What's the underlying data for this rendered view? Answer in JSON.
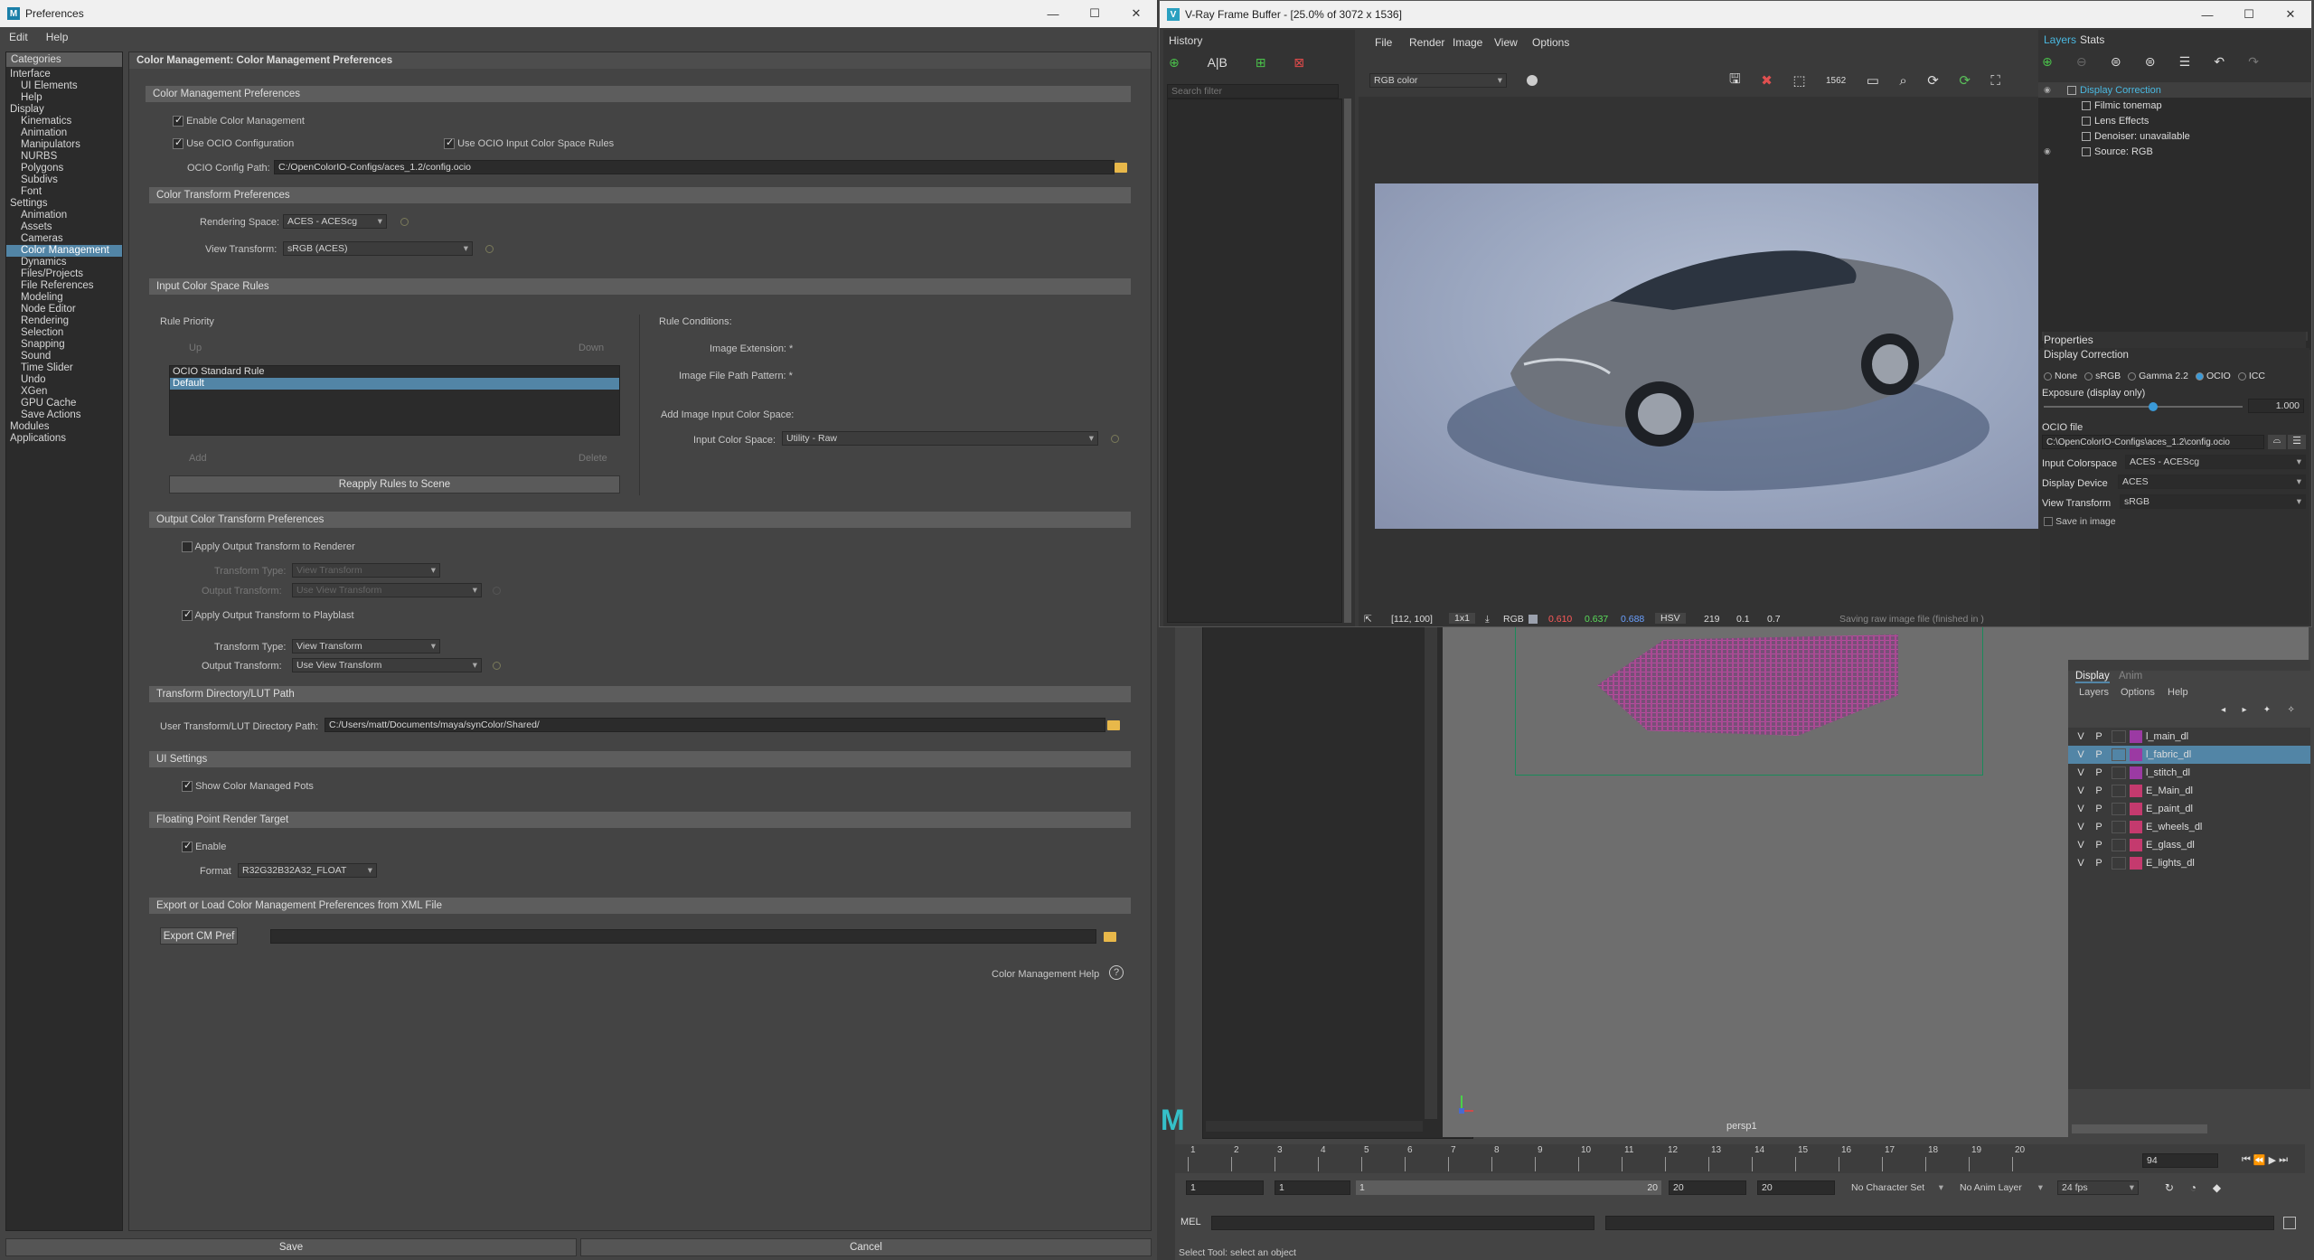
{
  "prefs": {
    "window_title": "Preferences",
    "menu": [
      "Edit",
      "Help"
    ],
    "categories_header": "Categories",
    "categories": [
      {
        "label": "Interface",
        "indent": 0
      },
      {
        "label": "UI Elements",
        "indent": 1
      },
      {
        "label": "Help",
        "indent": 1
      },
      {
        "label": "Display",
        "indent": 0
      },
      {
        "label": "Kinematics",
        "indent": 1
      },
      {
        "label": "Animation",
        "indent": 1
      },
      {
        "label": "Manipulators",
        "indent": 1
      },
      {
        "label": "NURBS",
        "indent": 1
      },
      {
        "label": "Polygons",
        "indent": 1
      },
      {
        "label": "Subdivs",
        "indent": 1
      },
      {
        "label": "Font",
        "indent": 1
      },
      {
        "label": "Settings",
        "indent": 0
      },
      {
        "label": "Animation",
        "indent": 1
      },
      {
        "label": "Assets",
        "indent": 1
      },
      {
        "label": "Cameras",
        "indent": 1
      },
      {
        "label": "Color Management",
        "indent": 1,
        "selected": true
      },
      {
        "label": "Dynamics",
        "indent": 1
      },
      {
        "label": "Files/Projects",
        "indent": 1
      },
      {
        "label": "File References",
        "indent": 1
      },
      {
        "label": "Modeling",
        "indent": 1
      },
      {
        "label": "Node Editor",
        "indent": 1
      },
      {
        "label": "Rendering",
        "indent": 1
      },
      {
        "label": "Selection",
        "indent": 1
      },
      {
        "label": "Snapping",
        "indent": 1
      },
      {
        "label": "Sound",
        "indent": 1
      },
      {
        "label": "Time Slider",
        "indent": 1
      },
      {
        "label": "Undo",
        "indent": 1
      },
      {
        "label": "XGen",
        "indent": 1
      },
      {
        "label": "GPU Cache",
        "indent": 1
      },
      {
        "label": "Save Actions",
        "indent": 1
      },
      {
        "label": "Modules",
        "indent": 0
      },
      {
        "label": "Applications",
        "indent": 0
      }
    ],
    "page_title": "Color Management: Color Management Preferences",
    "sec_cm": "Color Management Preferences",
    "enable_cm": "Enable Color Management",
    "use_ocio": "Use OCIO Configuration",
    "use_ocio_rules": "Use OCIO Input Color Space Rules",
    "ocio_path_label": "OCIO Config Path:",
    "ocio_path": "C:/OpenColorIO-Configs/aces_1.2/config.ocio",
    "sec_ct": "Color Transform Preferences",
    "rendering_space_label": "Rendering Space:",
    "rendering_space": "ACES - ACEScg",
    "view_transform_label": "View Transform:",
    "view_transform": "sRGB (ACES)",
    "sec_icsr": "Input Color Space Rules",
    "rule_priority": "Rule Priority",
    "up": "Up",
    "down": "Down",
    "rules": [
      "OCIO Standard Rule",
      "Default"
    ],
    "add": "Add",
    "delete": "Delete",
    "reapply": "Reapply Rules to Scene",
    "rule_conditions": "Rule Conditions:",
    "image_ext_label": "Image Extension: *",
    "image_path_label": "Image File Path Pattern: *",
    "add_rule_label": "Add Image Input Color Space:",
    "input_cs_label": "Input Color Space:",
    "input_cs": "Utility - Raw",
    "sec_oct": "Output Color Transform Preferences",
    "apply_renderer": "Apply Output Transform to Renderer",
    "transform_type_label": "Transform Type:",
    "transform_type_dis": "View Transform",
    "output_transform_label": "Output Transform:",
    "output_transform_dis": "Use View Transform",
    "apply_playblast": "Apply Output Transform to Playblast",
    "transform_type": "View Transform",
    "output_transform": "Use View Transform",
    "sec_lut": "Transform Directory/LUT Path",
    "lut_label": "User Transform/LUT Directory Path:",
    "lut_path": "C:/Users/matt/Documents/maya/synColor/Shared/",
    "sec_ui": "UI Settings",
    "show_pots": "Show Color Managed Pots",
    "sec_fp": "Floating Point Render Target",
    "enable": "Enable",
    "format_label": "Format",
    "format": "R32G32B32A32_FLOAT",
    "sec_xml": "Export or Load Color Management Preferences from XML File",
    "export_btn": "Export CM Pref",
    "help": "Color Management Help",
    "save": "Save",
    "cancel": "Cancel"
  },
  "vfb": {
    "window_title": "V-Ray Frame Buffer - [25.0% of 3072 x 1536]",
    "history": "History",
    "search_placeholder": "Search filter",
    "menu": [
      "File",
      "Render",
      "Image",
      "View",
      "Options"
    ],
    "channel": "RGB color",
    "layers_tab": "Layers",
    "stats_tab": "Stats",
    "layers": [
      {
        "label": "Display Correction",
        "selected": true
      },
      {
        "label": "Filmic tonemap"
      },
      {
        "label": "Lens Effects"
      },
      {
        "label": "Denoiser: unavailable"
      },
      {
        "label": "Source: RGB"
      }
    ],
    "properties": "Properties",
    "display_correction": "Display Correction",
    "radio": [
      "None",
      "sRGB",
      "Gamma 2.2",
      "OCIO",
      "ICC"
    ],
    "exposure_label": "Exposure (display only)",
    "exposure": "1.000",
    "exposure_level": 0.55,
    "ocio_file_label": "OCIO file",
    "ocio_file": "C:\\OpenColorIO-Configs\\aces_1.2\\config.ocio",
    "input_cs_label": "Input Colorspace",
    "input_cs": "ACES - ACEScg",
    "display_device_label": "Display Device",
    "display_device": "ACES",
    "view_transform_label": "View Transform",
    "view_transform": "sRGB",
    "save_in_image": "Save in image",
    "coords": "[112, 100]",
    "zoom": "1x1",
    "rgb_label": "RGB",
    "r": "0.610",
    "g": "0.637",
    "b": "0.688",
    "hsv_label": "HSV",
    "h": "219",
    "s": "0.1",
    "v": "0.7",
    "status": "Saving raw image file (finished in )",
    "colors": {
      "r": "#ff5a5a",
      "g": "#5adc5a",
      "b": "#6aa0ff"
    }
  },
  "maya": {
    "viewport_label": "persp1",
    "display_tab": "Display",
    "anim_tab": "Anim",
    "menu": [
      "Layers",
      "Options",
      "Help"
    ],
    "layers": [
      {
        "name": "l_main_dl",
        "color": "#9b3aa3"
      },
      {
        "name": "l_fabric_dl",
        "color": "#9b3aa3",
        "selected": true
      },
      {
        "name": "l_stitch_dl",
        "color": "#9b3aa3"
      },
      {
        "name": "E_Main_dl",
        "color": "#c43a6e"
      },
      {
        "name": "E_paint_dl",
        "color": "#c43a6e"
      },
      {
        "name": "E_wheels_dl",
        "color": "#c43a6e"
      },
      {
        "name": "E_glass_dl",
        "color": "#c43a6e"
      },
      {
        "name": "E_lights_dl",
        "color": "#c43a6e"
      }
    ],
    "vis": "V",
    "play": "P",
    "ticks": [
      "1",
      "2",
      "3",
      "4",
      "5",
      "6",
      "7",
      "8",
      "9",
      "10",
      "11",
      "12",
      "13",
      "14",
      "15",
      "16",
      "17",
      "18",
      "19",
      "20"
    ],
    "current_frame": "94",
    "range_start": "1",
    "range_start2": "1",
    "range_inner_start": "1",
    "range_inner_end": "20",
    "range_end": "20",
    "range_end2": "20",
    "char_set": "No Character Set",
    "anim_layer": "No Anim Layer",
    "fps": "24 fps",
    "mel": "MEL",
    "help_line": "Select Tool: select an object"
  }
}
